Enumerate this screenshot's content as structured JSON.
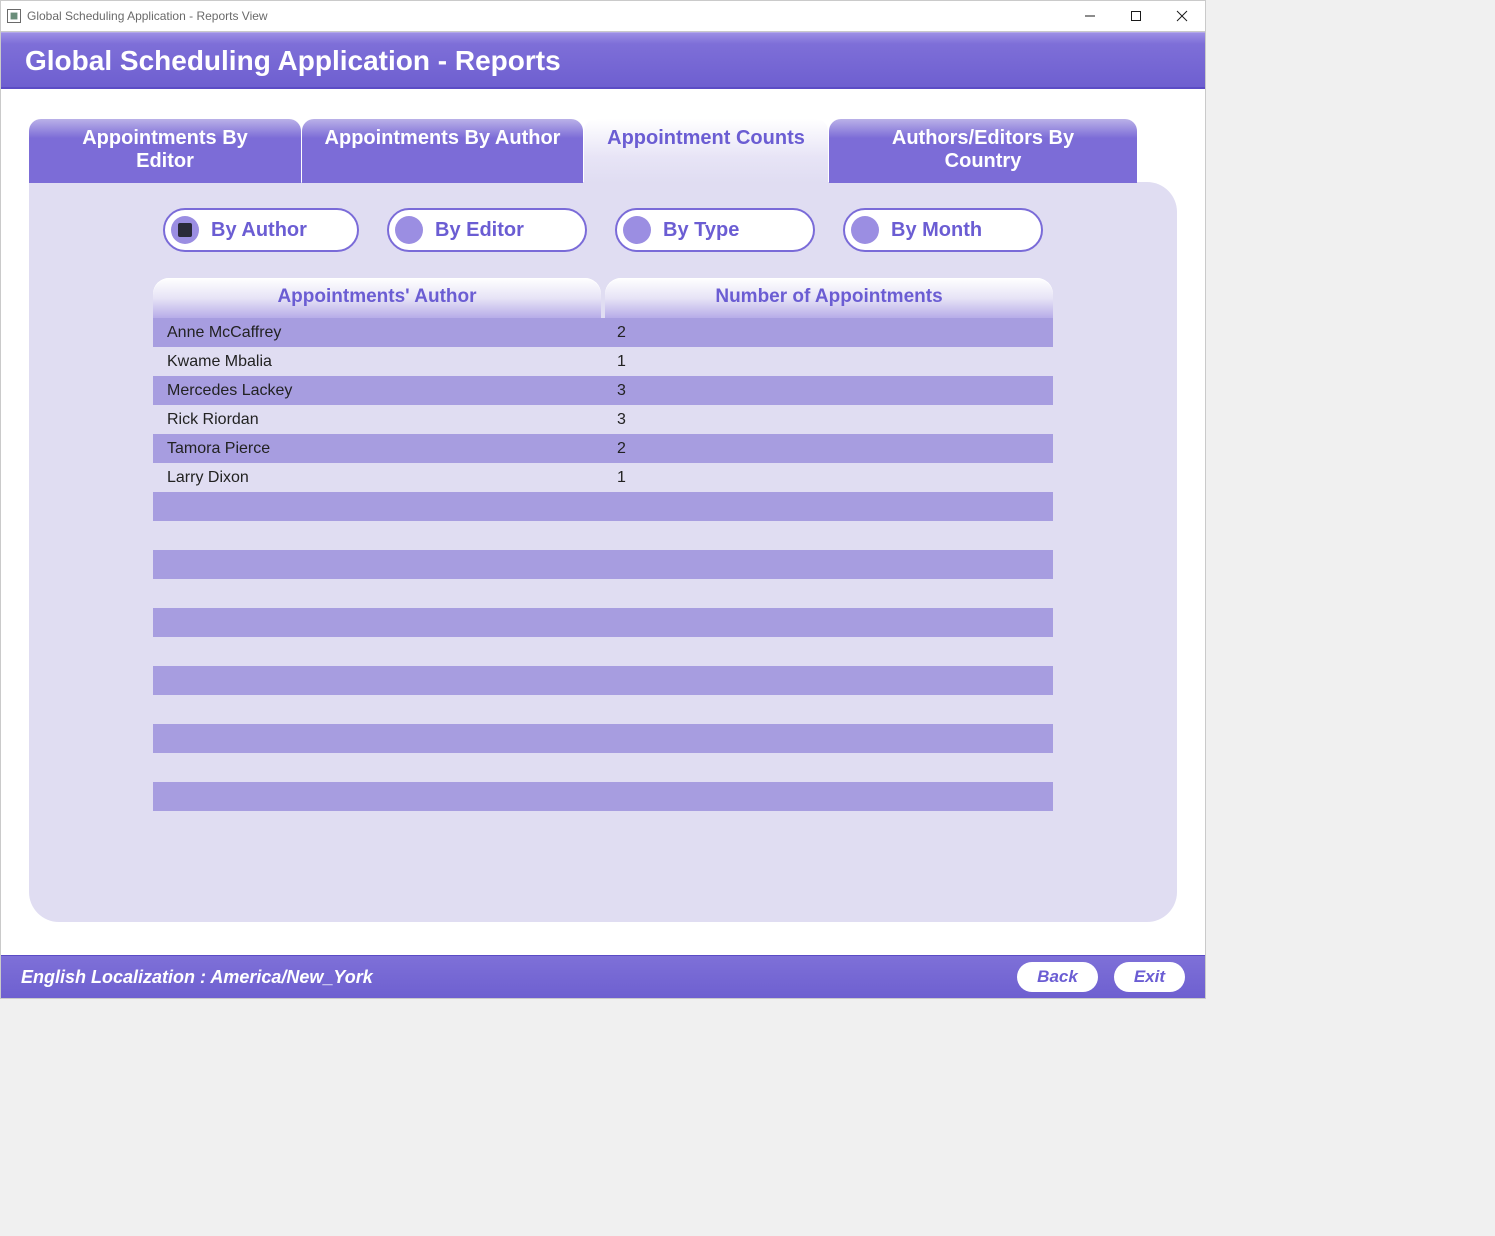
{
  "window": {
    "title": "Global Scheduling Application - Reports View"
  },
  "header": {
    "title": "Global Scheduling Application - Reports"
  },
  "tabs": [
    {
      "label": "Appointments By Editor",
      "active": false
    },
    {
      "label": "Appointments By Author",
      "active": false
    },
    {
      "label": "Appointment Counts",
      "active": true
    },
    {
      "label": "Authors/Editors By Country",
      "active": false
    }
  ],
  "radios": [
    {
      "label": "By Author",
      "selected": true
    },
    {
      "label": "By Editor",
      "selected": false
    },
    {
      "label": "By Type",
      "selected": false
    },
    {
      "label": "By Month",
      "selected": false
    }
  ],
  "table": {
    "headers": [
      "Appointments' Author",
      "Number of Appointments"
    ],
    "rows": [
      {
        "name": "Anne McCaffrey",
        "count": "2"
      },
      {
        "name": "Kwame Mbalia",
        "count": "1"
      },
      {
        "name": "Mercedes Lackey",
        "count": "3"
      },
      {
        "name": "Rick Riordan",
        "count": "3"
      },
      {
        "name": "Tamora Pierce",
        "count": "2"
      },
      {
        "name": "Larry Dixon",
        "count": "1"
      }
    ]
  },
  "footer": {
    "localization": "English Localization : America/New_York",
    "back_label": "Back",
    "exit_label": "Exit"
  }
}
